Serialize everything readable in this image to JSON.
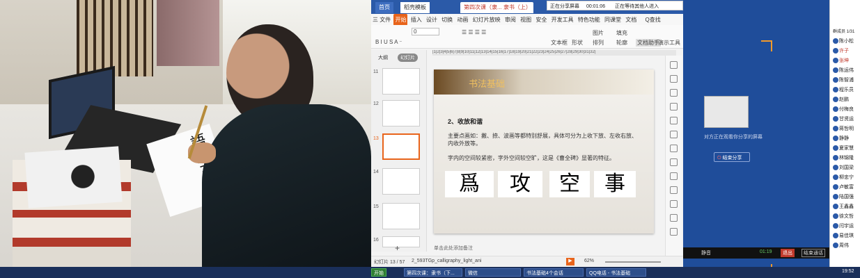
{
  "ppt": {
    "tabs": [
      "首页",
      "稻壳模板",
      "第四次课（隶... 隶书（上）"
    ],
    "share_bar": {
      "label": "正在分享屏幕",
      "timer": "00:01:06",
      "waiting": "正在等待其他人进入"
    },
    "menu": [
      "三 文件",
      "开始",
      "插入",
      "设计",
      "切换",
      "动画",
      "幻灯片放映",
      "审阅",
      "视图",
      "安全",
      "开发工具",
      "特色功能",
      "同课堂",
      "文档"
    ],
    "search_label": "Q查找",
    "font_size": "0",
    "ribbon_labels": {
      "textbox": "文本框",
      "shape": "形状",
      "arrange": "排列",
      "picture": "图片",
      "fill": "填充",
      "outline": "轮廓",
      "doc_assist": "文档助手",
      "presenter": "演示工具"
    },
    "panel_tabs": {
      "outline": "大纲",
      "slides": "幻灯片"
    },
    "slide_numbers": [
      "11",
      "12",
      "13",
      "14",
      "15",
      "16"
    ],
    "slide": {
      "title": "书法基础",
      "heading": "2、收放和谐",
      "para1": "主要点画如：撇、捺、波画等都特别舒展，具体可分为上收下放、左收右放、内收外放等。",
      "para2": "字内的空间较紧密，字外空间较空旷，这是《曹全碑》显著的特征。",
      "chars": [
        "爲",
        "攻",
        "空",
        "事"
      ]
    },
    "notes_placeholder": "单击此处添加备注",
    "status": {
      "slide_count": "幻灯片 13 / 57",
      "theme": "2_593TGp_calligraphy_light_ani",
      "zoom": "62%"
    }
  },
  "share": {
    "caption": "对方正在观看你分享的屏幕",
    "stop_button": "结束分享",
    "bottom_bar": {
      "mute": "静音",
      "time": "01:19",
      "exit": "退出",
      "end_call": "结束通话"
    }
  },
  "members": {
    "header": "群成员 1/31",
    "list": [
      "陈小松",
      "许子",
      "张坤",
      "陈运伟",
      "陈智浦",
      "程乐员",
      "赵鹏",
      "付梅良",
      "甘贤运",
      "蒋哲明",
      "静静",
      "夏家慧",
      "林锦隆",
      "刘国梁",
      "柳忠宁",
      "卢敏富",
      "陆国强",
      "王鑫鑫",
      "徐文哲",
      "闫宇运",
      "易佳琪",
      "周伟"
    ]
  },
  "taskbar": {
    "start": "开始",
    "items": [
      "第四次课：隶书（下...",
      "微信",
      "书法基础4个会话",
      "QQ电话 - 书法基础"
    ],
    "clock": "19:52"
  },
  "photo": {
    "paper_chars": "語三王一"
  },
  "colors": {
    "accent": "#e8641b",
    "tab_blue": "#2b5aa8",
    "share_bg": "#1f4d9a",
    "stop_red": "#c0392b"
  }
}
